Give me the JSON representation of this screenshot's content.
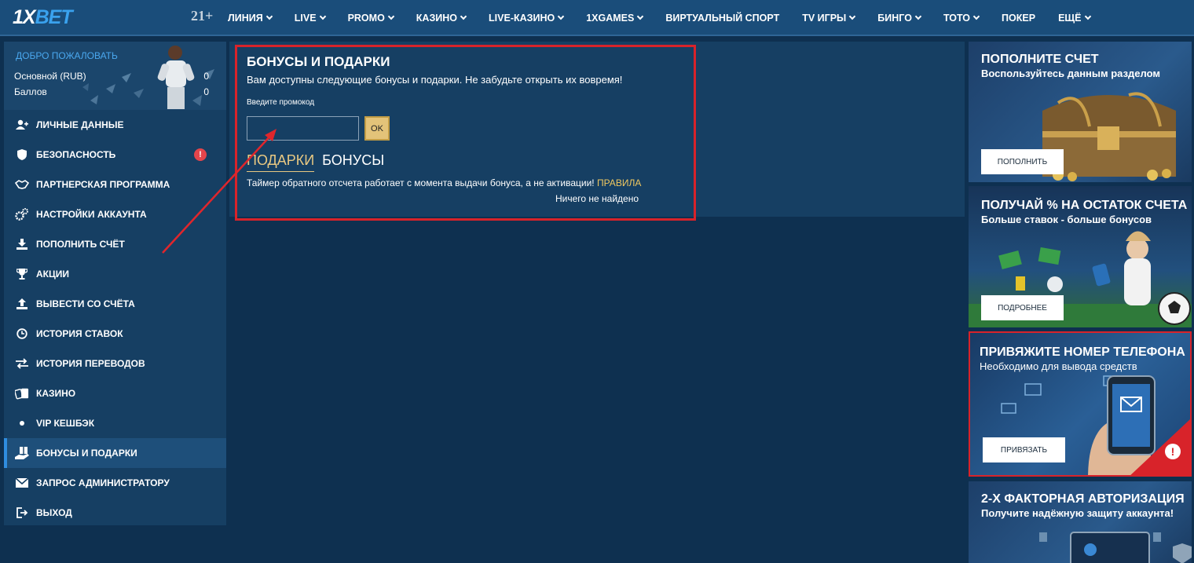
{
  "header": {
    "logo_x": "1X",
    "logo_bet": "BET",
    "age_badge": "21+",
    "nav": [
      {
        "label": "ЛИНИЯ",
        "dropdown": true
      },
      {
        "label": "LIVE",
        "dropdown": true
      },
      {
        "label": "PROMO",
        "dropdown": true
      },
      {
        "label": "КАЗИНО",
        "dropdown": true
      },
      {
        "label": "LIVE-КАЗИНО",
        "dropdown": true
      },
      {
        "label": "1XGAMES",
        "dropdown": true
      },
      {
        "label": "ВИРТУАЛЬНЫЙ СПОРТ",
        "dropdown": false
      },
      {
        "label": "TV ИГРЫ",
        "dropdown": true
      },
      {
        "label": "БИНГО",
        "dropdown": true
      },
      {
        "label": "ТОТО",
        "dropdown": true
      },
      {
        "label": "ПОКЕР",
        "dropdown": false
      },
      {
        "label": "ЕЩЁ",
        "dropdown": true
      }
    ]
  },
  "sidebar": {
    "welcome": "ДОБРО ПОЖАЛОВАТЬ",
    "account_label": "Основной (RUB)",
    "account_value": "0",
    "points_label": "Баллов",
    "points_value": "0",
    "items": [
      {
        "label": "ЛИЧНЫЕ ДАННЫЕ",
        "icon": "user-add-icon"
      },
      {
        "label": "БЕЗОПАСНОСТЬ",
        "icon": "shield-icon",
        "alert": "!"
      },
      {
        "label": "ПАРТНЕРСКАЯ ПРОГРАММА",
        "icon": "handshake-icon"
      },
      {
        "label": "НАСТРОЙКИ АККАУНТА",
        "icon": "gears-icon"
      },
      {
        "label": "ПОПОЛНИТЬ СЧЁТ",
        "icon": "download-icon"
      },
      {
        "label": "АКЦИИ",
        "icon": "trophy-icon"
      },
      {
        "label": "ВЫВЕСТИ СО СЧЁТА",
        "icon": "upload-icon"
      },
      {
        "label": "ИСТОРИЯ СТАВОК",
        "icon": "clock-icon"
      },
      {
        "label": "ИСТОРИЯ ПЕРЕВОДОВ",
        "icon": "transfer-arrows-icon"
      },
      {
        "label": "КАЗИНО",
        "icon": "cards-icon"
      },
      {
        "label": "VIP КЕШБЭК",
        "icon": "dot-icon"
      },
      {
        "label": "БОНУСЫ И ПОДАРКИ",
        "icon": "gift-hand-icon",
        "active": true
      },
      {
        "label": "ЗАПРОС АДМИНИСТРАТОРУ",
        "icon": "envelope-icon"
      },
      {
        "label": "ВЫХОД",
        "icon": "logout-icon"
      }
    ]
  },
  "bonus": {
    "title": "БОНУСЫ И ПОДАРКИ",
    "subtitle": "Вам доступны следующие бонусы и подарки. Не забудьте открыть их вовремя!",
    "promo_label": "Введите промокод",
    "promo_value": "",
    "ok_label": "OK",
    "tabs": [
      {
        "label": "ПОДАРКИ",
        "active": true
      },
      {
        "label": "БОНУСЫ",
        "active": false
      }
    ],
    "timer_text": "Таймер обратного отсчета работает с момента выдачи бонуса, а не активации!",
    "rules_link": "ПРАВИЛА",
    "empty_text": "Ничего не найдено"
  },
  "promos": [
    {
      "title": "ПОПОЛНИТЕ СЧЕТ",
      "subtitle": "Воспользуйтесь данным разделом",
      "button": "ПОПОЛНИТЬ"
    },
    {
      "title": "ПОЛУЧАЙ % НА ОСТАТОК СЧЕТА",
      "subtitle": "Больше ставок - больше бонусов",
      "button": "ПОДРОБНЕЕ"
    },
    {
      "title": "ПРИВЯЖИТЕ НОМЕР ТЕЛЕФОНА",
      "subtitle": "Необходимо для вывода средств",
      "button": "ПРИВЯЗАТЬ"
    },
    {
      "title": "2-Х ФАКТОРНАЯ АВТОРИЗАЦИЯ",
      "subtitle": "Получите надёжную защиту аккаунта!"
    }
  ],
  "colors": {
    "page_bg": "#0e3050",
    "nav_bg": "#1a4d7a",
    "panel_bg": "#163f63",
    "accent_blue": "#3aa2ee",
    "highlight_red": "#d8232a",
    "gold": "#e8c882"
  }
}
